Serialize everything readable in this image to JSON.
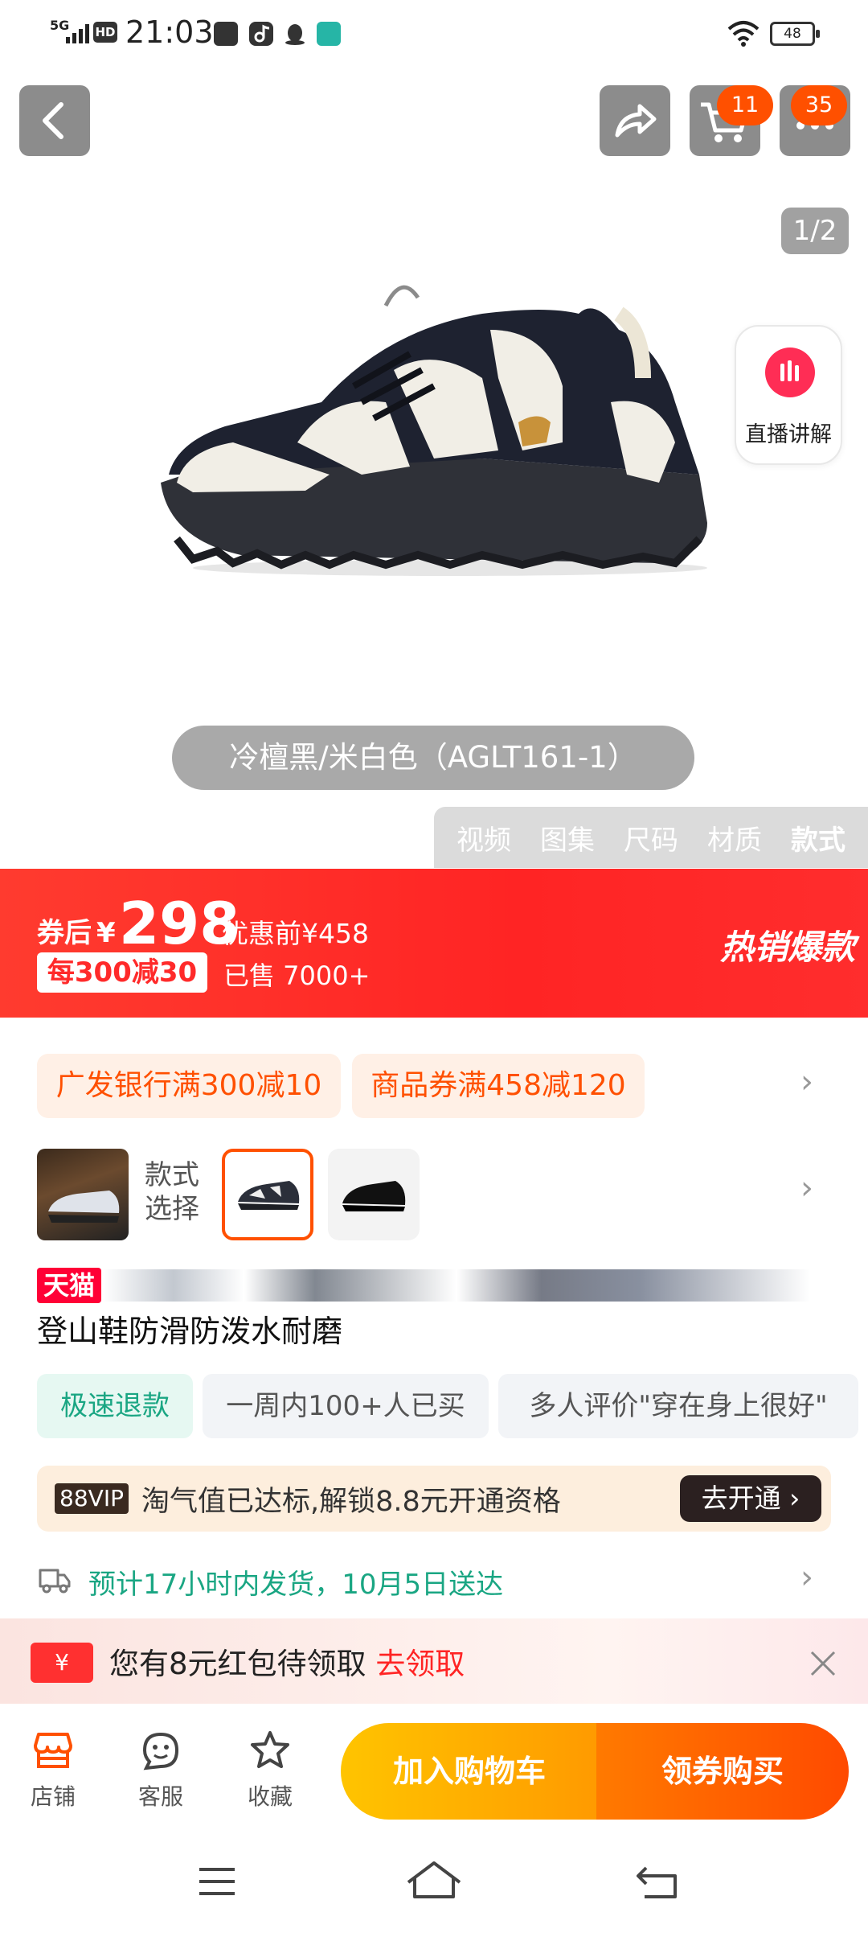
{
  "status_bar": {
    "network": "5G",
    "hd": "HD",
    "time": "21:03",
    "battery": "48"
  },
  "top_nav": {
    "cart_badge": "11",
    "more_badge": "35"
  },
  "gallery": {
    "counter": "1/2",
    "live_label": "直播讲解",
    "color_name": "冷檀黑/米白色（AGLT161-1）",
    "media_tabs": [
      "视频",
      "图集",
      "尺码",
      "材质",
      "款式"
    ],
    "active_tab": "款式"
  },
  "price_banner": {
    "after_coupon_label": "券后",
    "currency": "¥",
    "price": "298",
    "original_price": "优惠前¥458",
    "promo_chip": "每300减30",
    "sold": "已售 7000+",
    "hot_label": "热销爆款"
  },
  "coupons": [
    "广发银行满300减10",
    "商品券满458减120"
  ],
  "style_select": {
    "label": "款式选择",
    "label_line1": "款式",
    "label_line2": "选择"
  },
  "product": {
    "tmall_badge": "天猫",
    "title": "登山鞋防滑防泼水耐磨"
  },
  "tags": [
    "极速退款",
    "一周内100+人已买",
    "多人评价\"穿在身上很好\""
  ],
  "vip": {
    "logo": "88VIP",
    "text": "淘气值已达标,解锁8.8元开通资格",
    "button": "去开通 ›"
  },
  "shipping": {
    "text": "预计17小时内发货，10月5日送达"
  },
  "red_packet": {
    "icon": "¥",
    "text": "您有8元红包待领取",
    "claim": "去领取"
  },
  "bottom_bar": {
    "shop": "店铺",
    "service": "客服",
    "favorite": "收藏",
    "add_to_cart": "加入购物车",
    "buy": "领券购买"
  },
  "colors": {
    "accent": "#ff5000",
    "price_red": "#ff2424",
    "tmall_red": "#ff0036",
    "ship_green": "#1aa683"
  }
}
